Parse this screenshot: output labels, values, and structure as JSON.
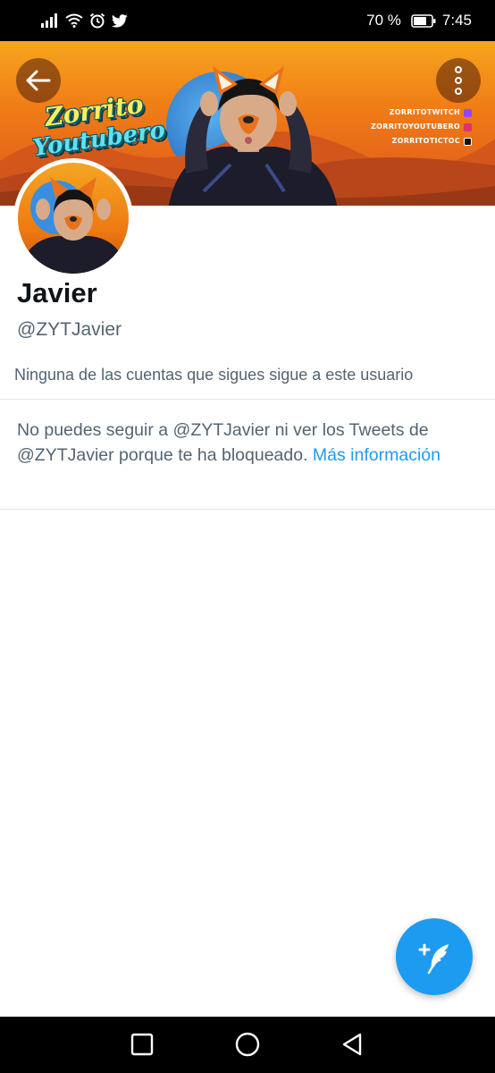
{
  "status_bar": {
    "battery_percent": "70 %",
    "time": "7:45",
    "icons": [
      "signal-icon",
      "wifi-icon",
      "alarm-icon",
      "twitter-icon",
      "battery-icon"
    ]
  },
  "banner": {
    "logo_line1": "Zorrito",
    "logo_line2": "Youtubero",
    "socials": [
      {
        "handle": "ZORRITOTWITCH",
        "icon": "twitch-icon",
        "color": "#9146ff"
      },
      {
        "handle": "ZORRITOYOUTUBERO",
        "icon": "instagram-icon",
        "color": "#e1306c"
      },
      {
        "handle": "ZORRITOTICTOC",
        "icon": "tiktok-icon",
        "color": "#111111"
      }
    ]
  },
  "profile": {
    "display_name": "Javier",
    "handle": "@ZYTJavier",
    "followers_note": "Ninguna de las cuentas que sigues sigue a este usuario"
  },
  "blocked": {
    "message": "No puedes seguir a @ZYTJavier ni ver los Tweets de @ZYTJavier porque te ha bloqueado.",
    "link_text": "Más información"
  },
  "colors": {
    "accent": "#1d9bf0",
    "secondary_text": "#536471",
    "primary_text": "#0f1419"
  }
}
